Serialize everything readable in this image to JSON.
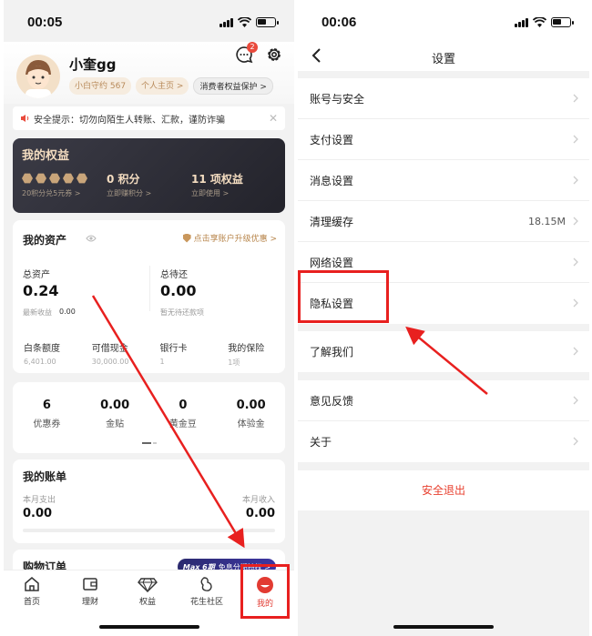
{
  "left": {
    "status": {
      "time": "00:05"
    },
    "user": {
      "name": "小奎gg",
      "chips": [
        "小白守约 567",
        "个人主页 >",
        "消费者权益保护 >"
      ],
      "msg_badge": "2"
    },
    "notice": {
      "text": "安全提示：切勿向陌生人转账、汇款，谨防诈骗",
      "close": "✕"
    },
    "rights": {
      "title": "我的权益",
      "cols": [
        {
          "big": "",
          "small": "20积分兑5元券 >"
        },
        {
          "big": "0 积分",
          "small": "立即赚积分 >"
        },
        {
          "big": "11 项权益",
          "small": "立即使用 >"
        }
      ]
    },
    "assets": {
      "title": "我的资产",
      "upgrade": "点击享账户升级优惠 >",
      "total_label": "总资产",
      "total_value": "0.24",
      "total_hint_label": "最新收益",
      "total_hint_value": "0.00",
      "repay_label": "总待还",
      "repay_value": "0.00",
      "repay_hint": "暂无待还款项",
      "grid": [
        {
          "label": "白条额度",
          "value": "6,401.00"
        },
        {
          "label": "可借现金",
          "value": "30,000.00"
        },
        {
          "label": "银行卡",
          "value": "1"
        },
        {
          "label": "我的保险",
          "value": "1项"
        }
      ]
    },
    "cards": [
      {
        "value": "6",
        "label": "优惠券"
      },
      {
        "value": "0.00",
        "label": "金贴"
      },
      {
        "value": "0",
        "label": "黄金豆"
      },
      {
        "value": "0.00",
        "label": "体验金"
      }
    ],
    "bill": {
      "title": "我的账单",
      "spend_label": "本月支出",
      "spend_value": "0.00",
      "income_label": "本月收入",
      "income_value": "0.00"
    },
    "order": {
      "title": "购物订单",
      "pill_brand": "Max 6期",
      "pill_text": "免息分期特权 >"
    },
    "tabs": [
      {
        "label": "首页",
        "icon": "home-icon"
      },
      {
        "label": "理财",
        "icon": "wallet-icon"
      },
      {
        "label": "权益",
        "icon": "diamond-icon"
      },
      {
        "label": "花生社区",
        "icon": "peanut-icon"
      },
      {
        "label": "我的",
        "icon": "profile-icon",
        "active": true
      }
    ]
  },
  "right": {
    "status": {
      "time": "00:06"
    },
    "title": "设置",
    "group1": [
      {
        "label": "账号与安全"
      },
      {
        "label": "支付设置"
      },
      {
        "label": "消息设置"
      },
      {
        "label": "清理缓存",
        "value": "18.15M"
      },
      {
        "label": "网络设置"
      },
      {
        "label": "隐私设置"
      }
    ],
    "group2": [
      {
        "label": "了解我们"
      }
    ],
    "group3": [
      {
        "label": "意见反馈"
      },
      {
        "label": "关于"
      }
    ],
    "logout": "安全退出"
  },
  "colors": {
    "accent_red": "#e8201f",
    "logout_red": "#e8402f",
    "gold": "#f1d5ae"
  }
}
